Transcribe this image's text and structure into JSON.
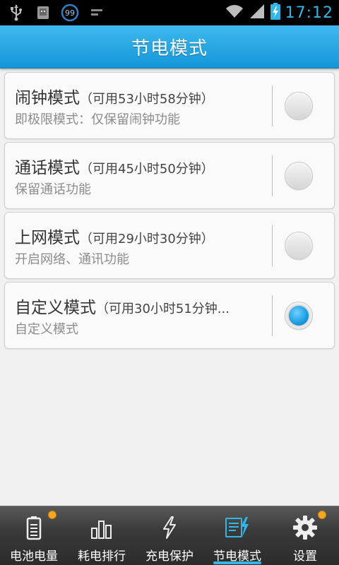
{
  "status_bar": {
    "time": "17:12",
    "notif_badge": "99",
    "icons": [
      "usb-icon",
      "android-icon",
      "notification-99-icon",
      "wifi-icon",
      "signal-icon",
      "battery-charging-icon"
    ]
  },
  "header": {
    "title": "节电模式"
  },
  "modes": [
    {
      "name": "闹钟模式",
      "available": "（可用53小时58分钟）",
      "desc": "即极限模式：仅保留闹钟功能",
      "selected": false
    },
    {
      "name": "通话模式",
      "available": "（可用45小时50分钟）",
      "desc": "保留通话功能",
      "selected": false
    },
    {
      "name": "上网模式",
      "available": "（可用29小时30分钟）",
      "desc": "开启网络、通讯功能",
      "selected": false
    },
    {
      "name": "自定义模式",
      "available": "（可用30小时51分钟...",
      "desc": "自定义模式",
      "selected": true
    }
  ],
  "tabs": [
    {
      "label": "电池电量",
      "icon": "battery-icon",
      "active": false,
      "badge": true
    },
    {
      "label": "耗电排行",
      "icon": "bar-chart-icon",
      "active": false,
      "badge": false
    },
    {
      "label": "充电保护",
      "icon": "lightning-icon",
      "active": false,
      "badge": false
    },
    {
      "label": "节电模式",
      "icon": "power-save-list-icon",
      "active": true,
      "badge": false
    },
    {
      "label": "设置",
      "icon": "gear-icon",
      "active": false,
      "badge": true
    }
  ],
  "colors": {
    "accent": "#33b5e5",
    "titlebar": "#1497d8",
    "badge": "#f5a623"
  }
}
